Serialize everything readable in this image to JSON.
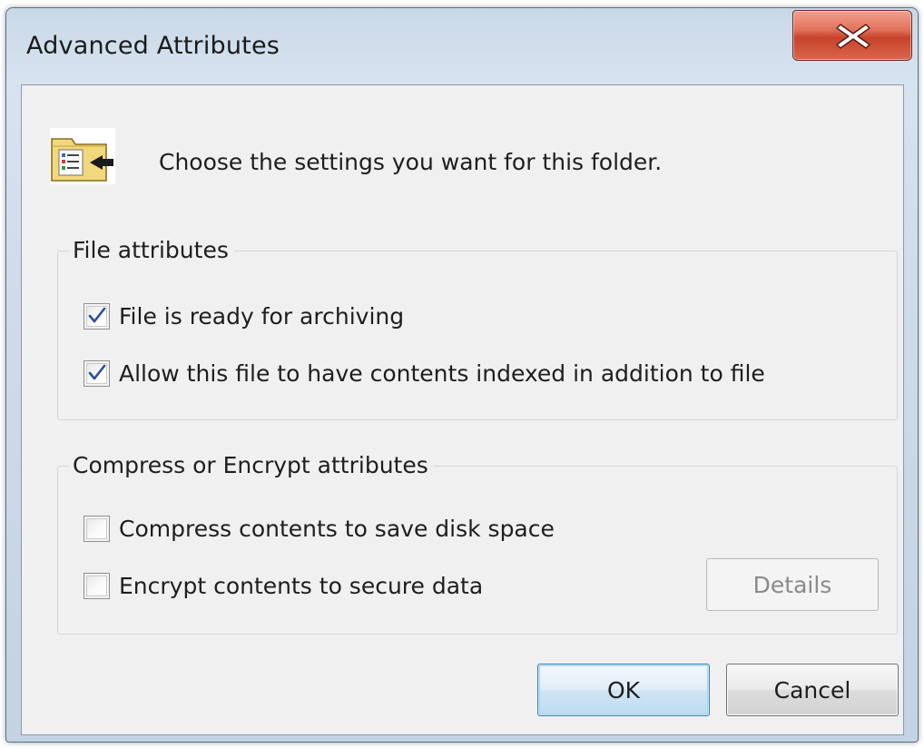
{
  "window": {
    "title": "Advanced Attributes",
    "close_icon": "close-icon"
  },
  "header": {
    "icon": "folder-attributes-icon",
    "prompt": "Choose the settings you want for this folder."
  },
  "file_attributes": {
    "legend": "File attributes",
    "options": [
      {
        "label": "File is ready for archiving",
        "checked": true
      },
      {
        "label": "Allow this file to have contents indexed in addition to file",
        "checked": true
      }
    ]
  },
  "compress_encrypt": {
    "legend": "Compress or Encrypt attributes",
    "options": [
      {
        "label": "Compress contents to save disk space",
        "checked": false
      },
      {
        "label": "Encrypt contents to secure data",
        "checked": false
      }
    ],
    "details_label": "Details",
    "details_enabled": false
  },
  "buttons": {
    "ok_label": "OK",
    "cancel_label": "Cancel"
  },
  "colors": {
    "close_button": "#c7432b",
    "check_mark": "#2b4f9c",
    "ok_border": "#3c7fb1"
  }
}
